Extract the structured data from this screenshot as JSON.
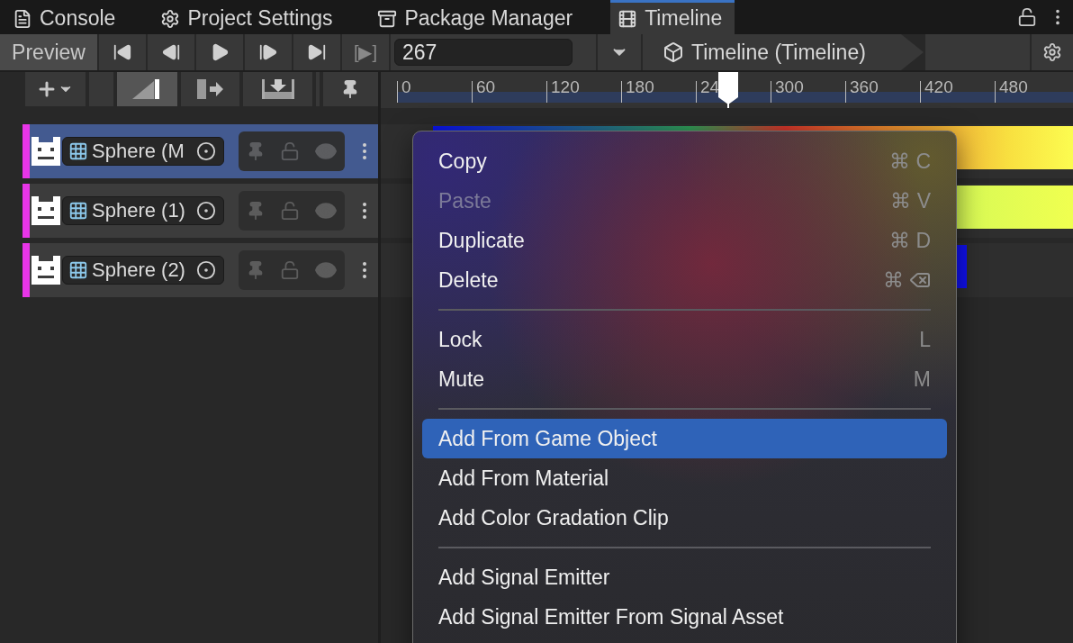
{
  "tabs": [
    {
      "label": "Console",
      "selected": false
    },
    {
      "label": "Project Settings",
      "selected": false
    },
    {
      "label": "Package Manager",
      "selected": false
    },
    {
      "label": "Timeline",
      "selected": true
    }
  ],
  "toolbar": {
    "preview": {
      "label": "Preview",
      "on": true
    },
    "brackets": "[▶]",
    "frame": "267",
    "breadcrumb": "Timeline (Timeline)"
  },
  "ruler": {
    "labels": [
      "0",
      "60",
      "120",
      "180",
      "24",
      "300",
      "360",
      "420",
      "480"
    ]
  },
  "tracks": [
    {
      "name": "Sphere (M",
      "selected": true
    },
    {
      "name": "Sphere (1)",
      "selected": false
    },
    {
      "name": "Sphere (2)",
      "selected": false
    }
  ],
  "menu": [
    {
      "kind": "item",
      "label": "Copy",
      "shortcut": "⌘ C",
      "disabled": false,
      "selected": false
    },
    {
      "kind": "item",
      "label": "Paste",
      "shortcut": "⌘ V",
      "disabled": true,
      "selected": false
    },
    {
      "kind": "item",
      "label": "Duplicate",
      "shortcut": "⌘ D",
      "disabled": false,
      "selected": false
    },
    {
      "kind": "keyed",
      "label": "Delete",
      "shortcut": "⌘",
      "disabled": false,
      "selected": false
    },
    {
      "kind": "separator"
    },
    {
      "kind": "item",
      "label": "Lock",
      "shortcut": "L",
      "disabled": false,
      "selected": false
    },
    {
      "kind": "item",
      "label": "Mute",
      "shortcut": "M",
      "disabled": false,
      "selected": false
    },
    {
      "kind": "separator"
    },
    {
      "kind": "item",
      "label": "Add From Game Object",
      "disabled": false,
      "selected": true
    },
    {
      "kind": "item",
      "label": "Add From Material",
      "disabled": false,
      "selected": false
    },
    {
      "kind": "item",
      "label": "Add Color Gradation Clip",
      "disabled": false,
      "selected": false
    },
    {
      "kind": "separator"
    },
    {
      "kind": "item",
      "label": "Add Signal Emitter",
      "disabled": false,
      "selected": false
    },
    {
      "kind": "item",
      "label": "Add Signal Emitter From Signal Asset",
      "disabled": false,
      "selected": false
    }
  ]
}
